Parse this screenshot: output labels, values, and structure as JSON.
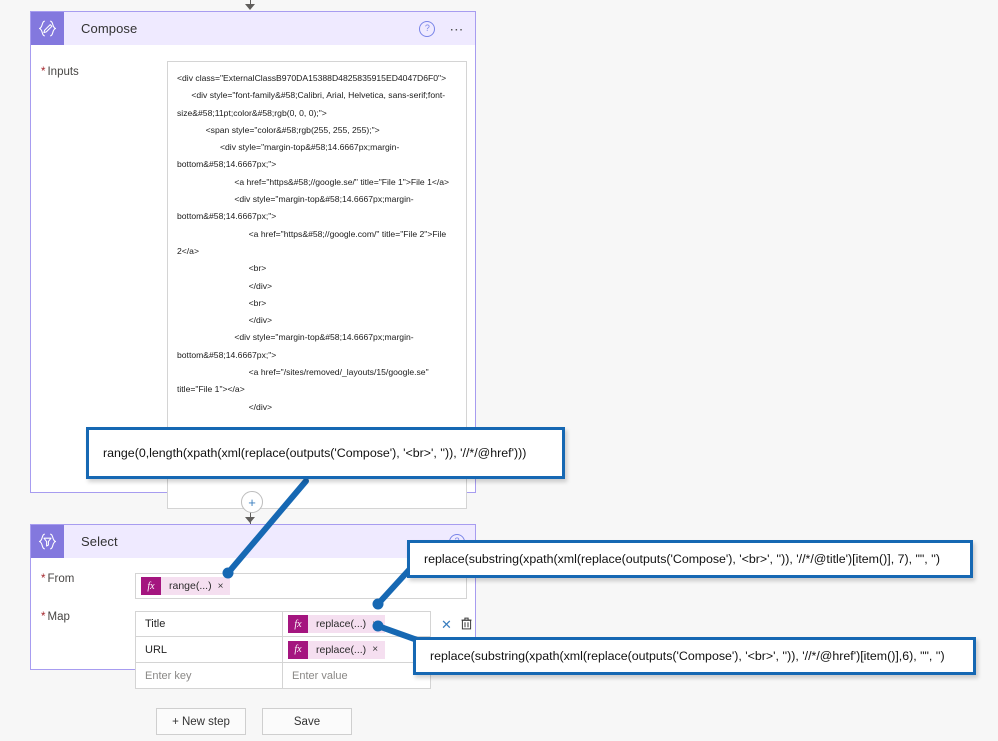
{
  "compose": {
    "title": "Compose",
    "icon": "compose-braces-pencil-icon",
    "help_icon": "help-circle-icon",
    "more_icon": "ellipsis-icon",
    "inputs_label": "Inputs",
    "required_marker": "*",
    "inputs_value": "<div class=\"ExternalClassB970DA15388D4825835915ED4047D6F0\">\n      <div style=\"font-family&#58;Calibri, Arial, Helvetica, sans-serif;font-size&#58;11pt;color&#58;rgb(0, 0, 0);\">\n            <span style=\"color&#58;rgb(255, 255, 255);\">\n                  <div style=\"margin-top&#58;14.6667px;margin-bottom&#58;14.6667px;\">\n                        <a href=\"https&#58;//google.se/\" title=\"File 1\">File 1</a>\n                        <div style=\"margin-top&#58;14.6667px;margin-bottom&#58;14.6667px;\">\n                              <a href=\"https&#58;//google.com/\" title=\"File 2\">File 2</a>\n                              <br>\n                              </div>\n                              <br>\n                              </div>\n                        <div style=\"margin-top&#58;14.6667px;margin-bottom&#58;14.6667px;\">\n                              <a href=\"/sites/removed/_layouts/15/google.se\" title=\"File 1\"></a>\n                              </div>"
  },
  "select": {
    "title": "Select",
    "icon": "select-braces-funnel-icon",
    "help_icon": "help-circle-icon",
    "from_label": "From",
    "map_label": "Map",
    "required_marker": "*",
    "from_token": {
      "fx": "fx",
      "text": "range(...)",
      "remove": "×"
    },
    "map_rows": [
      {
        "key": "Title",
        "value_token": {
          "fx": "fx",
          "text": "replace(...)",
          "remove": "×"
        },
        "close_icon": "close-icon",
        "delete_icon": "trash-icon"
      },
      {
        "key": "URL",
        "value_token": {
          "fx": "fx",
          "text": "replace(...)",
          "remove": "×"
        },
        "close_icon": "close-icon",
        "delete_icon": ""
      }
    ],
    "new_row": {
      "key_placeholder": "Enter key",
      "value_placeholder": "Enter value"
    }
  },
  "connectors": {
    "add_step_icon": "+"
  },
  "footer": {
    "new_step_label": "+ New step",
    "save_label": "Save"
  },
  "annotations": [
    {
      "id": "callout-1",
      "text": "range(0,length(xpath(xml(replace(outputs('Compose'), '<br>', '')), '//*/@href')))"
    },
    {
      "id": "callout-2",
      "text": "replace(substring(xpath(xml(replace(outputs('Compose'), '<br>', '')), '//*/@title')[item()], 7), \"\", '')"
    },
    {
      "id": "callout-3",
      "text": "replace(substring(xpath(xml(replace(outputs('Compose'), '<br>', '')), '//*/@href')[item()],6), \"\", '')"
    }
  ],
  "colors": {
    "card_accent": "#8378de",
    "card_header_bg": "#efeaff",
    "callout_border": "#1668b3",
    "token_fx": "#a4157f",
    "token_bg": "#f5dff0",
    "required": "#a4262c",
    "canvas_bg": "#f7f7f7"
  }
}
